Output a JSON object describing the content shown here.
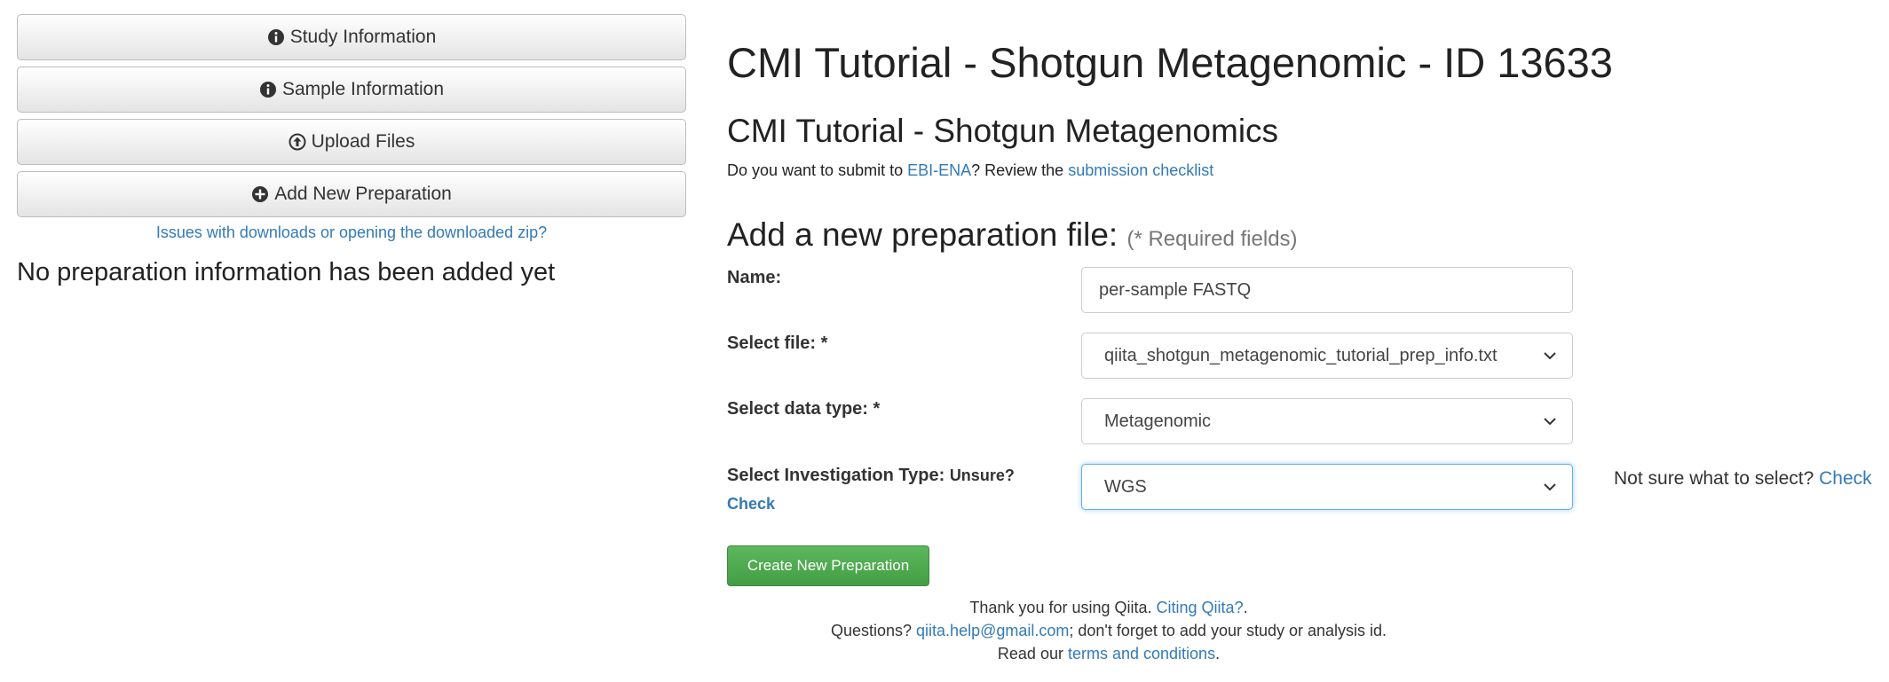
{
  "sidebar": {
    "buttons": [
      {
        "label": "Study Information",
        "icon": "info-icon"
      },
      {
        "label": "Sample Information",
        "icon": "info-icon"
      },
      {
        "label": "Upload Files",
        "icon": "upload-icon"
      },
      {
        "label": "Add New Preparation",
        "icon": "plus-circle-icon"
      }
    ],
    "download_issue_link": "Issues with downloads or opening the downloaded zip?",
    "no_prep_message": "No preparation information has been added yet"
  },
  "main": {
    "study_title": "CMI Tutorial - Shotgun Metagenomic - ID 13633",
    "study_subtitle": "CMI Tutorial - Shotgun Metagenomics",
    "ebi": {
      "prefix": "Do you want to submit to ",
      "ebi_link": "EBI-ENA",
      "middle": "? Review the ",
      "checklist_link": "submission checklist"
    },
    "form": {
      "heading": "Add a new preparation file:",
      "required_note": "(* Required fields)",
      "name_label": "Name:",
      "name_value": "per-sample FASTQ",
      "file_label": "Select file: *",
      "file_value": "qiita_shotgun_metagenomic_tutorial_prep_info.txt",
      "data_type_label": "Select data type: *",
      "data_type_value": "Metagenomic",
      "investigation_label": "Select Investigation Type:",
      "unsure_label": "Unsure?",
      "check_link": "Check",
      "investigation_value": "WGS",
      "not_sure_text": "Not sure what to select?",
      "not_sure_link": "Check",
      "create_button": "Create New Preparation"
    }
  },
  "footer": {
    "thanks": "Thank you for using Qiita.",
    "citing_link": "Citing Qiita?",
    "citing_suffix": ".",
    "questions": "Questions?",
    "email_link": "qiita.help@gmail.com",
    "questions_suffix": "; don't forget to add your study or analysis id.",
    "read_our": "Read our",
    "terms_link": "terms and conditions",
    "terms_suffix": "."
  },
  "colors": {
    "link": "#337ab7",
    "primary_button": "#5cb85c",
    "focus_border": "#66afe9"
  }
}
